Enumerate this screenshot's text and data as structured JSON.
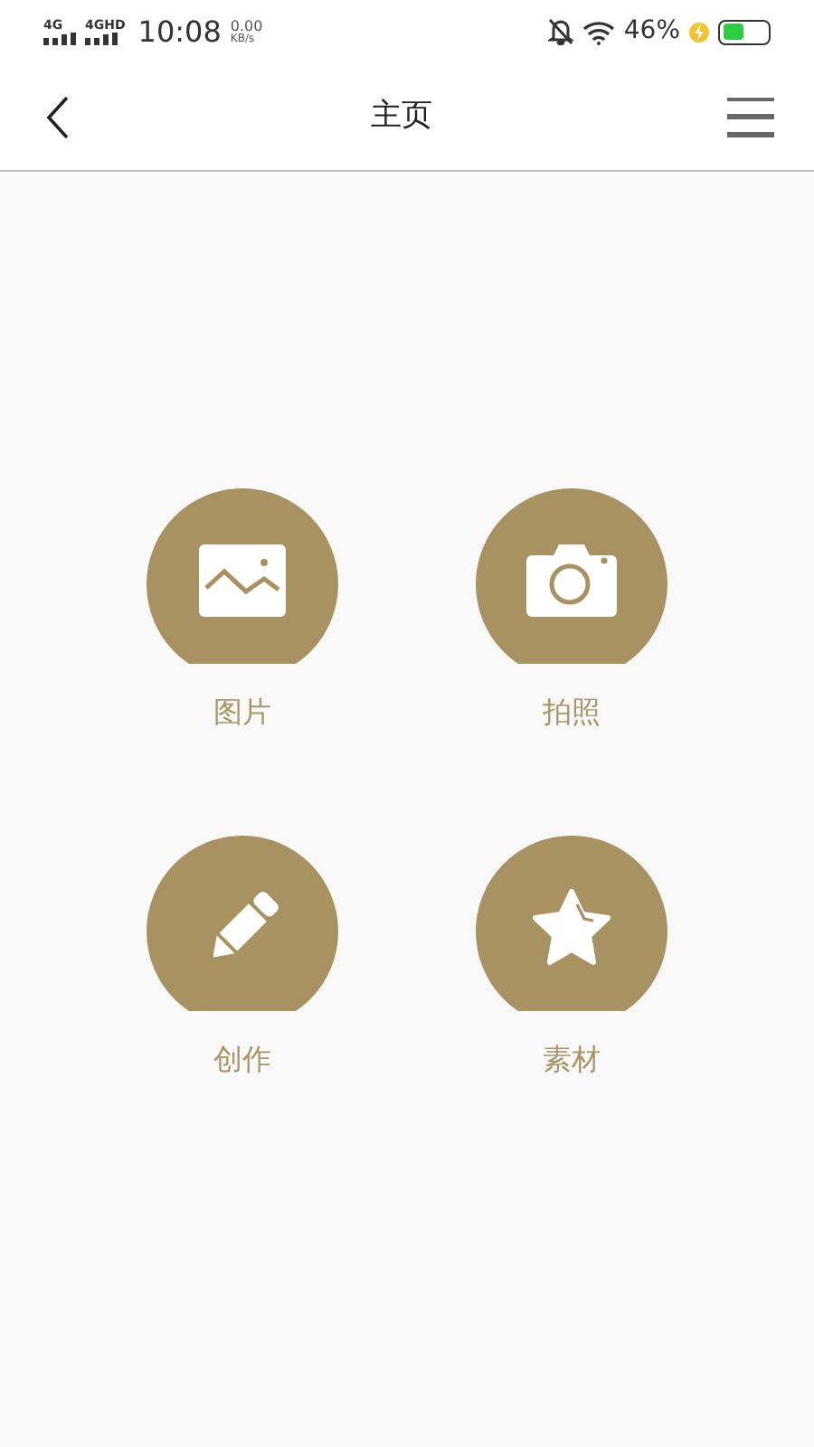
{
  "status_bar": {
    "sim_1": "4G",
    "sim_2": "4GHD",
    "time": "10:08",
    "speed": "0.00",
    "speed_unit": "KB/s",
    "battery_percent": "46%",
    "charging": true
  },
  "header": {
    "title": "主页"
  },
  "tiles": [
    {
      "kind": "image",
      "label": "图片"
    },
    {
      "kind": "camera",
      "label": "拍照"
    },
    {
      "kind": "pencil",
      "label": "创作"
    },
    {
      "kind": "star",
      "label": "素材"
    }
  ]
}
